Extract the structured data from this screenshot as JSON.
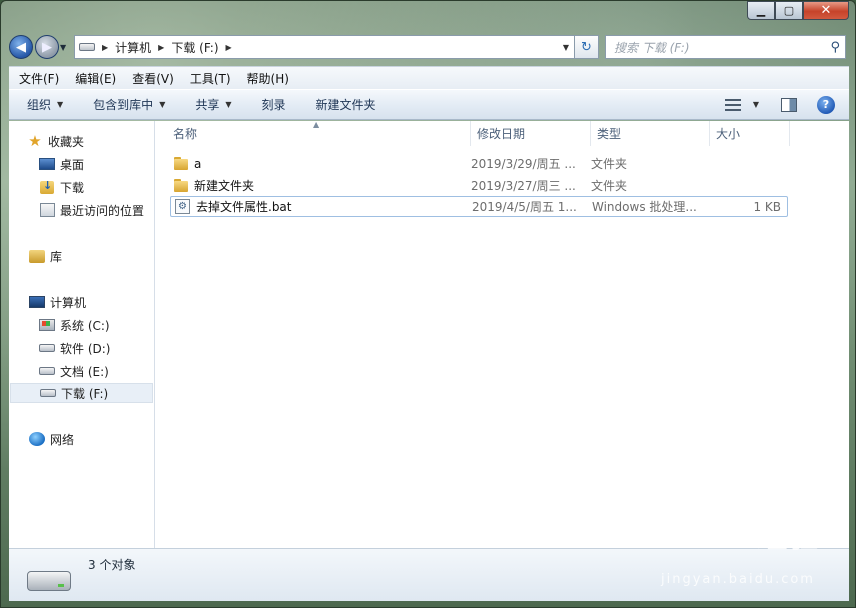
{
  "window": {
    "caption": {
      "minimize": "▁",
      "maximize": "▢",
      "close": "✕"
    }
  },
  "nav": {
    "back": "◀",
    "forward": "▶",
    "breadcrumb": [
      "计算机",
      "下载 (F:)"
    ],
    "search_placeholder": "搜索 下载 (F:)"
  },
  "menubar": {
    "items": [
      "文件(F)",
      "编辑(E)",
      "查看(V)",
      "工具(T)",
      "帮助(H)"
    ]
  },
  "toolbar": {
    "organize": "组织",
    "include_in_library": "包含到库中",
    "share": "共享",
    "burn": "刻录",
    "new_folder": "新建文件夹"
  },
  "sidebar": {
    "favorites": "收藏夹",
    "desktop": "桌面",
    "downloads": "下载",
    "recent": "最近访问的位置",
    "libraries": "库",
    "computer": "计算机",
    "drives": [
      {
        "label": "系统 (C:)",
        "icon": "system-drive-icon"
      },
      {
        "label": "软件 (D:)",
        "icon": "drive-icon"
      },
      {
        "label": "文档 (E:)",
        "icon": "drive-icon"
      },
      {
        "label": "下载 (F:)",
        "icon": "drive-icon",
        "selected": true
      }
    ],
    "network": "网络"
  },
  "columns": {
    "name": "名称",
    "date": "修改日期",
    "type": "类型",
    "size": "大小"
  },
  "files": [
    {
      "name": "a",
      "date": "2019/3/29/周五 ...",
      "type": "文件夹",
      "size": "",
      "icon": "folder-icon"
    },
    {
      "name": "新建文件夹",
      "date": "2019/3/27/周三 ...",
      "type": "文件夹",
      "size": "",
      "icon": "folder-icon"
    },
    {
      "name": "去掉文件属性.bat",
      "date": "2019/4/5/周五 1...",
      "type": "Windows 批处理...",
      "size": "1 KB",
      "icon": "batch-file-icon",
      "selected": true
    }
  ],
  "status": {
    "count": "3 个对象"
  },
  "watermark": {
    "brand": "Baidu经验",
    "url": "jingyan.baidu.com"
  }
}
